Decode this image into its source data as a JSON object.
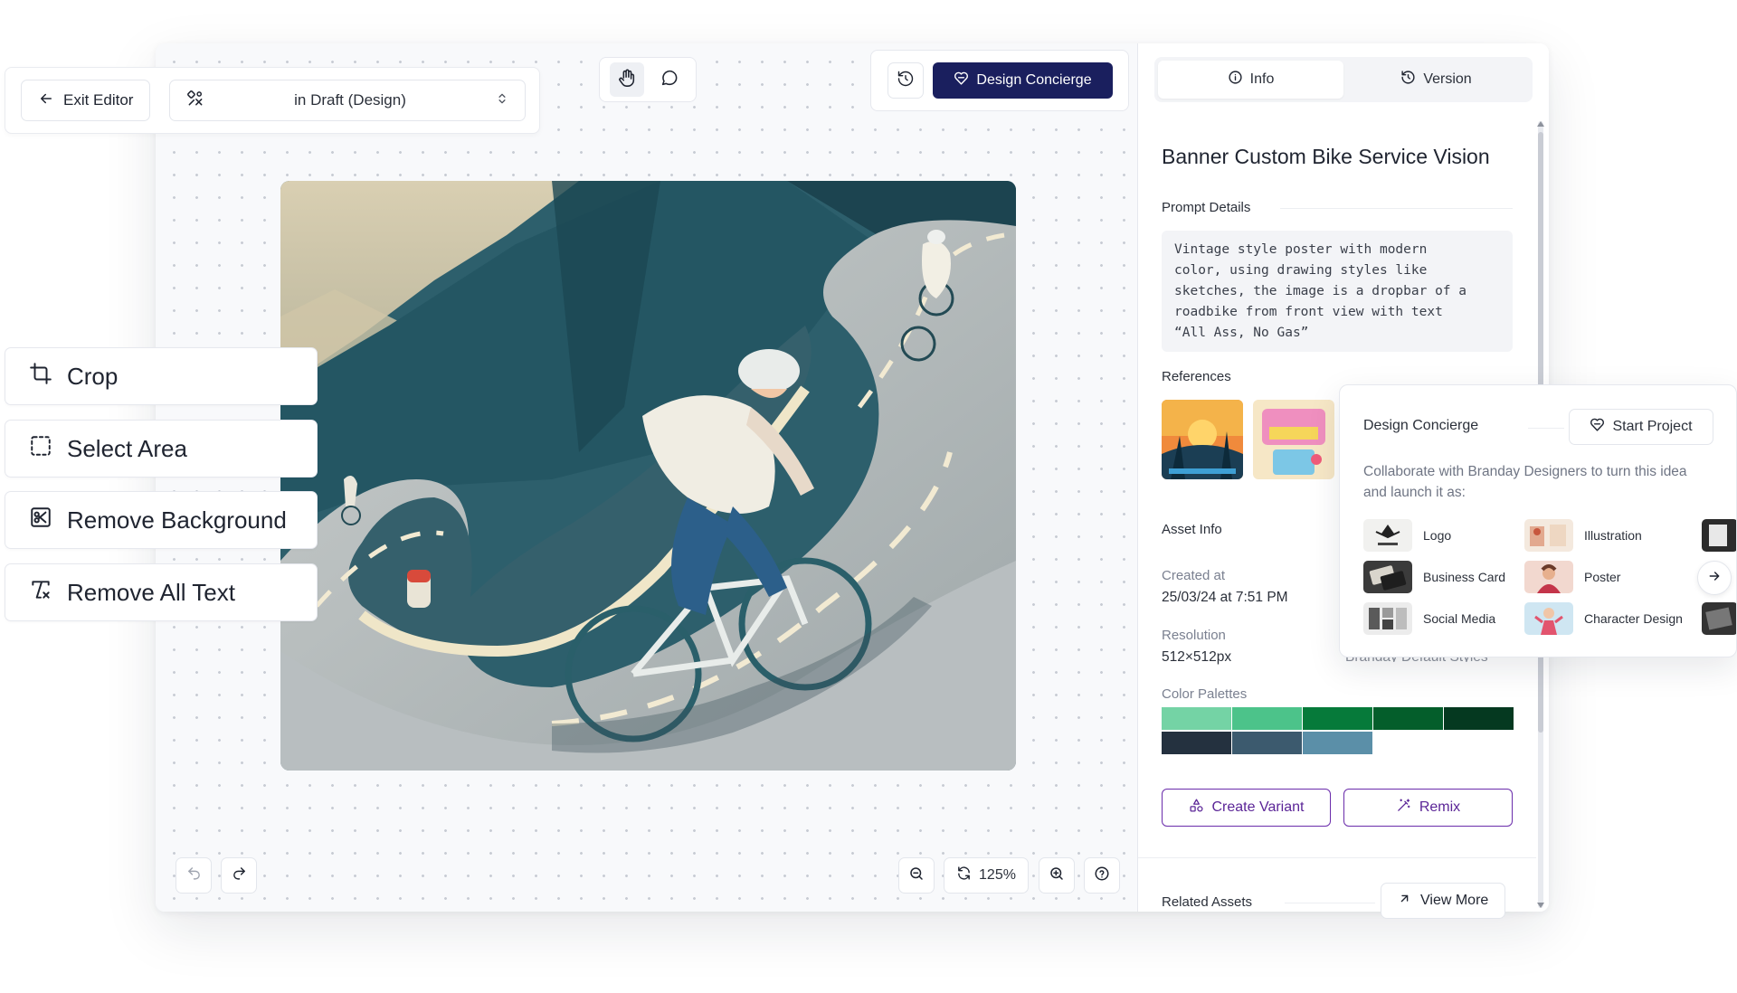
{
  "topbar": {
    "exit_label": "Exit Editor",
    "status_select": "in Draft (Design)"
  },
  "toolbar": {
    "concierge_label": "Design Concierge"
  },
  "tools": [
    {
      "label": "Crop",
      "icon": "crop-icon"
    },
    {
      "label": "Select Area",
      "icon": "select-area-icon"
    },
    {
      "label": "Remove Background",
      "icon": "remove-background-icon"
    },
    {
      "label": "Remove All Text",
      "icon": "remove-text-icon"
    }
  ],
  "canvas_controls": {
    "zoom": "125%"
  },
  "sidebar": {
    "tabs": [
      {
        "label": "Info",
        "icon": "info-icon",
        "active": true
      },
      {
        "label": "Version",
        "icon": "history-icon",
        "active": false
      }
    ],
    "title": "Banner Custom Bike Service Vision",
    "prompt_heading": "Prompt Details",
    "prompt_text": "Vintage style poster with modern\ncolor, using drawing styles like\nsketches, the image is a dropbar of a\nroadbike from front view with text\n“All Ass, No Gas”",
    "references_heading": "References",
    "asset_info_heading": "Asset Info",
    "created_label": "Created at",
    "created_value": "25/03/24 at 7:51 PM",
    "resolution_label": "Resolution",
    "resolution_value": "512×512px",
    "style_value_partial": "Branday Default Styles",
    "palettes_label": "Color Palettes",
    "palette_colors": [
      "#74d3a5",
      "#4cc38a",
      "#067a3a",
      "#045e2b",
      "#053920",
      "#24313f",
      "#3c5a6e",
      "#5b8fa8"
    ],
    "create_variant_label": "Create Variant",
    "remix_label": "Remix",
    "related_heading": "Related Assets",
    "view_more_label": "View More"
  },
  "concierge_popup": {
    "title": "Design Concierge",
    "start_label": "Start Project",
    "description": "Collaborate with Branday Designers to turn this idea and launch it as:",
    "items": [
      {
        "label": "Logo"
      },
      {
        "label": "Illustration"
      },
      {
        "label": "Business Card"
      },
      {
        "label": "Poster"
      },
      {
        "label": "Social Media"
      },
      {
        "label": "Character Design"
      }
    ]
  },
  "colors": {
    "concierge_button": "#1a1f5e",
    "accent_purple": "#6a2cab"
  }
}
